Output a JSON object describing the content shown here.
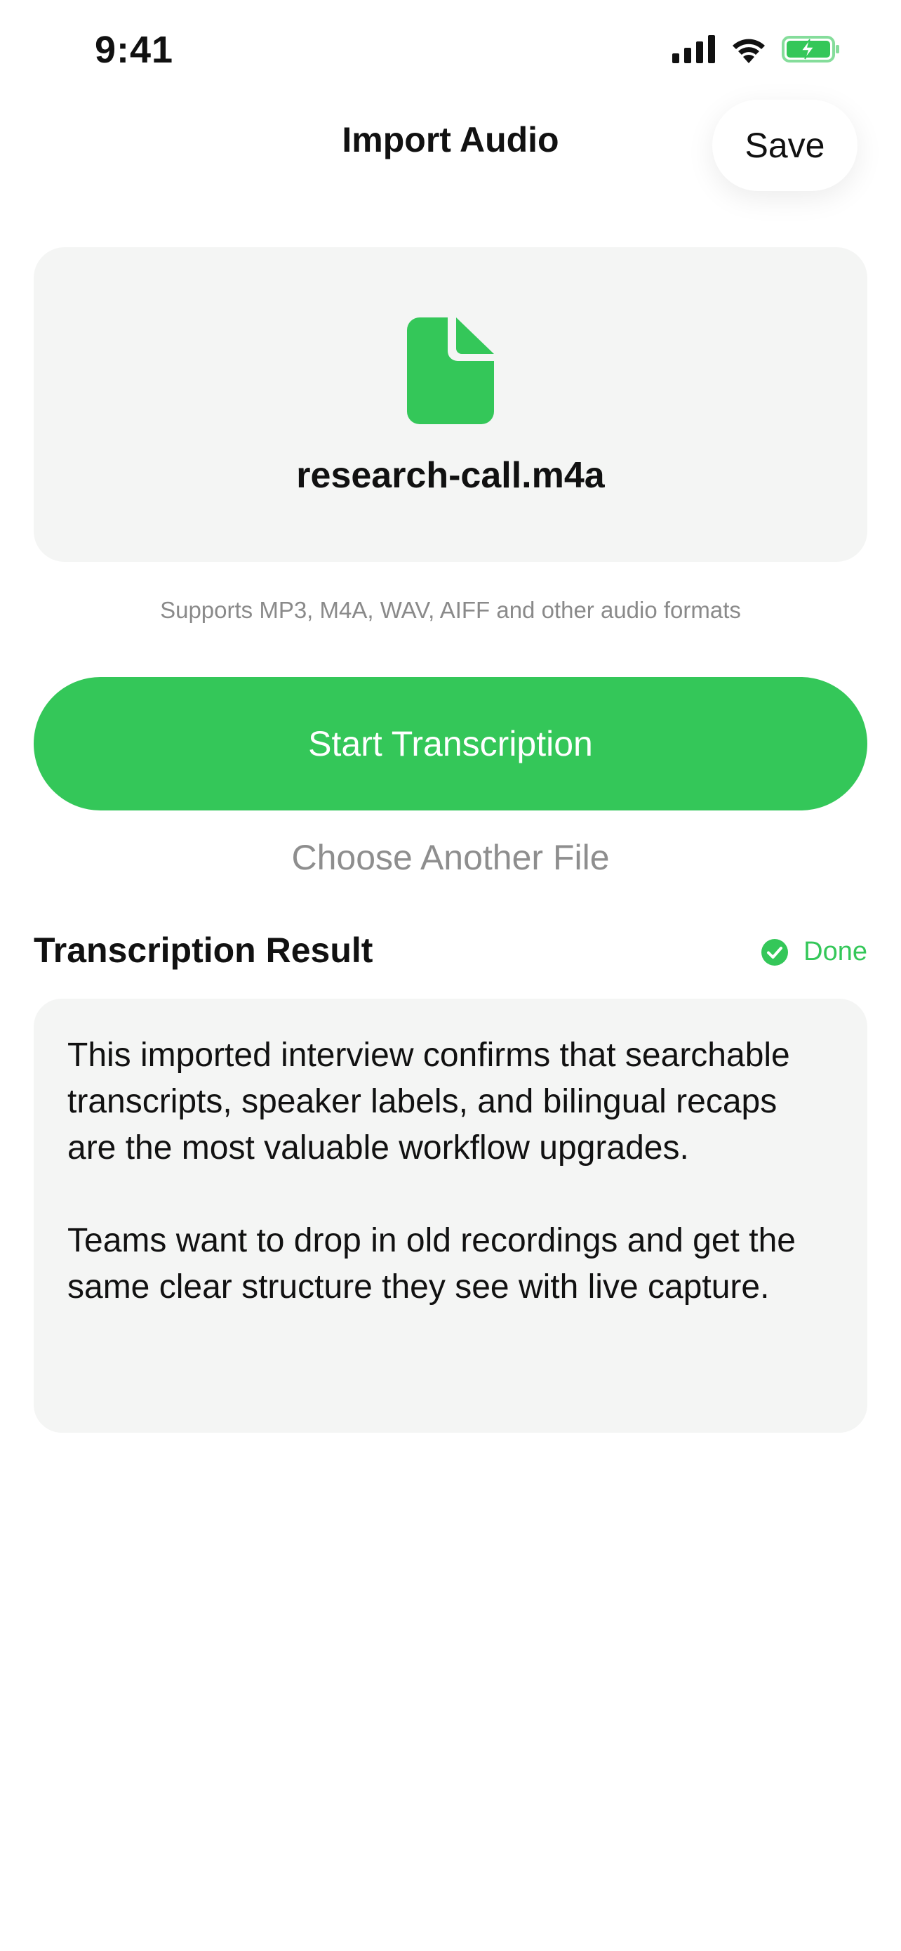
{
  "status_bar": {
    "time": "9:41"
  },
  "nav": {
    "title": "Import Audio",
    "save_label": "Save"
  },
  "file": {
    "icon": "document-icon",
    "name": "research-call.m4a"
  },
  "formats_hint": "Supports MP3, M4A, WAV, AIFF and other audio formats",
  "actions": {
    "start_label": "Start Transcription",
    "choose_label": "Choose Another File"
  },
  "result": {
    "title": "Transcription Result",
    "status": "Done",
    "paragraphs": [
      "This imported interview confirms that searchable transcripts, speaker labels, and bilingual recaps are the most valuable workflow upgrades.",
      "Teams want to drop in old recordings and get the same clear structure they see with live capture."
    ]
  },
  "colors": {
    "accent": "#34c759",
    "card_background": "#f4f5f4",
    "secondary_text": "#8e8e8e"
  }
}
